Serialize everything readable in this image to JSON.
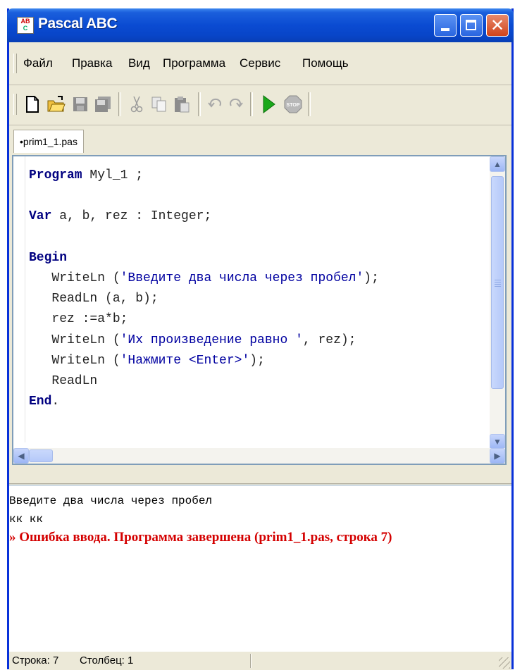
{
  "window": {
    "title": "Pascal ABC",
    "icon_label_top": "AB",
    "icon_label_bottom": "C"
  },
  "menu": [
    "Файл",
    "Правка",
    "Вид",
    "Программа",
    "Сервис",
    "Помощь"
  ],
  "toolbar": {
    "buttons": [
      "new-file-icon",
      "open-folder-icon",
      "save-icon",
      "save-all-icon",
      "cut-icon",
      "copy-icon",
      "paste-icon",
      "undo-icon",
      "redo-icon",
      "run-icon",
      "stop-icon"
    ],
    "stop_label": "STOP"
  },
  "tab": {
    "label": "prim1_1.pas",
    "modified_marker": "•"
  },
  "editor": {
    "lines": [
      {
        "kw": "Program",
        "rest": " Myl_1 ;"
      },
      {
        "kw": "",
        "rest": ""
      },
      {
        "kw": "Var",
        "rest": " a, b, rez : Integer;"
      },
      {
        "kw": "",
        "rest": ""
      },
      {
        "kw": "Begin",
        "rest": ""
      },
      {
        "pre": "   WriteLn (",
        "str": "'Введите два числа через пробел'",
        "post": ");"
      },
      {
        "pre": "   ReadLn (a, b);"
      },
      {
        "pre": "   rez :=a*b;"
      },
      {
        "pre": "   WriteLn (",
        "str": "'Их произведение равно '",
        "post": ", rez);"
      },
      {
        "pre": "   WriteLn (",
        "str": "'Нажмите <Enter>'",
        "post": ");"
      },
      {
        "pre": "   ReadLn"
      },
      {
        "kw": "End",
        "rest": "."
      }
    ]
  },
  "output": {
    "lines": [
      "Введите два числа через пробел",
      "кк кк"
    ],
    "error_marker": "»",
    "error": "Ошибка ввода. Программа завершена (prim1_1.pas, строка 7)"
  },
  "status": {
    "row": "Строка: 7",
    "col": "Столбец: 1"
  },
  "colors": {
    "keyword": "#000080",
    "string": "#0000a0",
    "error": "#d40000",
    "titlebar": "#0a4bd2"
  }
}
